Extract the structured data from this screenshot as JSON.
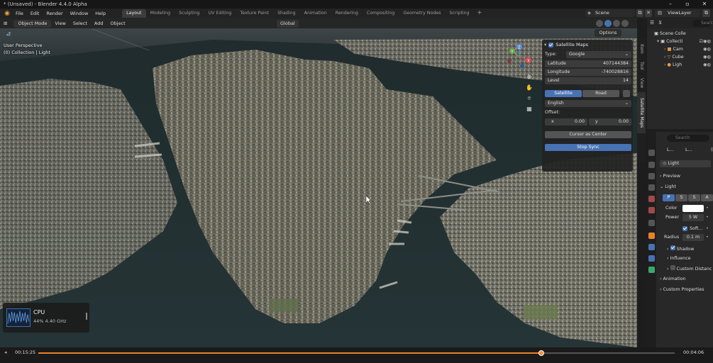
{
  "window": {
    "title": "* (Unsaved) - Blender 4.4.0 Alpha"
  },
  "menu": [
    "File",
    "Edit",
    "Render",
    "Window",
    "Help"
  ],
  "workspaces": {
    "active": "Layout",
    "tabs": [
      "Layout",
      "Modeling",
      "Sculpting",
      "UV Editing",
      "Texture Paint",
      "Shading",
      "Animation",
      "Rendering",
      "Compositing",
      "Geometry Nodes",
      "Scripting"
    ]
  },
  "scene": {
    "name": "Scene",
    "view_layer": "ViewLayer"
  },
  "viewport": {
    "mode": "Object Mode",
    "menus": [
      "View",
      "Select",
      "Add",
      "Object"
    ],
    "transform": "Global",
    "options_label": "Options",
    "perspective": "User Perspective",
    "collection": "(0) Collection | Light",
    "gizmo_axes": [
      "X",
      "Y",
      "Z"
    ]
  },
  "cpu_widget": {
    "label": "CPU",
    "value": "44% 4.40 GHz"
  },
  "satellite_panel": {
    "header": "Satellite Maps",
    "type_label": "Type:",
    "type_value": "Google",
    "latitude_label": "Latitude",
    "latitude_value": "407144384",
    "longitude_label": "Longitude",
    "longitude_value": "-740028816",
    "level_label": "Level",
    "level_value": "14",
    "mode_satellite": "Satellite",
    "mode_road": "Road",
    "language": "English",
    "offset_label": "Offset:",
    "x_label": "x",
    "x_value": "0.00",
    "y_label": "y",
    "y_value": "0.00",
    "cursor_btn": "Cursor as Center",
    "stop_btn": "Stop Sync"
  },
  "sidebar_tabs": [
    "Item",
    "Tool",
    "View",
    "Satellite Maps"
  ],
  "outliner": {
    "search_placeholder": "Search",
    "root": "Scene Colle",
    "collection": "Collecti",
    "items": [
      "Cam",
      "Cube",
      "Ligh"
    ]
  },
  "properties": {
    "search_placeholder": "Search",
    "breadcrumb_a": "L...",
    "breadcrumb_b": "L...",
    "object_name": "Light",
    "preview": "Preview",
    "light": "Light",
    "light_types": [
      "P",
      "S",
      "S",
      "A"
    ],
    "color_label": "Color",
    "power_label": "Power",
    "power_value": "5 W",
    "soft_label": "Soft...",
    "radius_label": "Radius",
    "radius_value": "0.1 m",
    "shadow": "Shadow",
    "influence": "Influence",
    "custom_distance": "Custom Distanc",
    "animation": "Animation",
    "custom_props": "Custom Properties"
  },
  "timeline": {
    "current": "00:15:25",
    "total": "00:04:06",
    "progress": 0.79
  },
  "colors": {
    "accent_blue": "#4772b3",
    "orange": "#e8822a",
    "panel_bg": "#282828"
  }
}
